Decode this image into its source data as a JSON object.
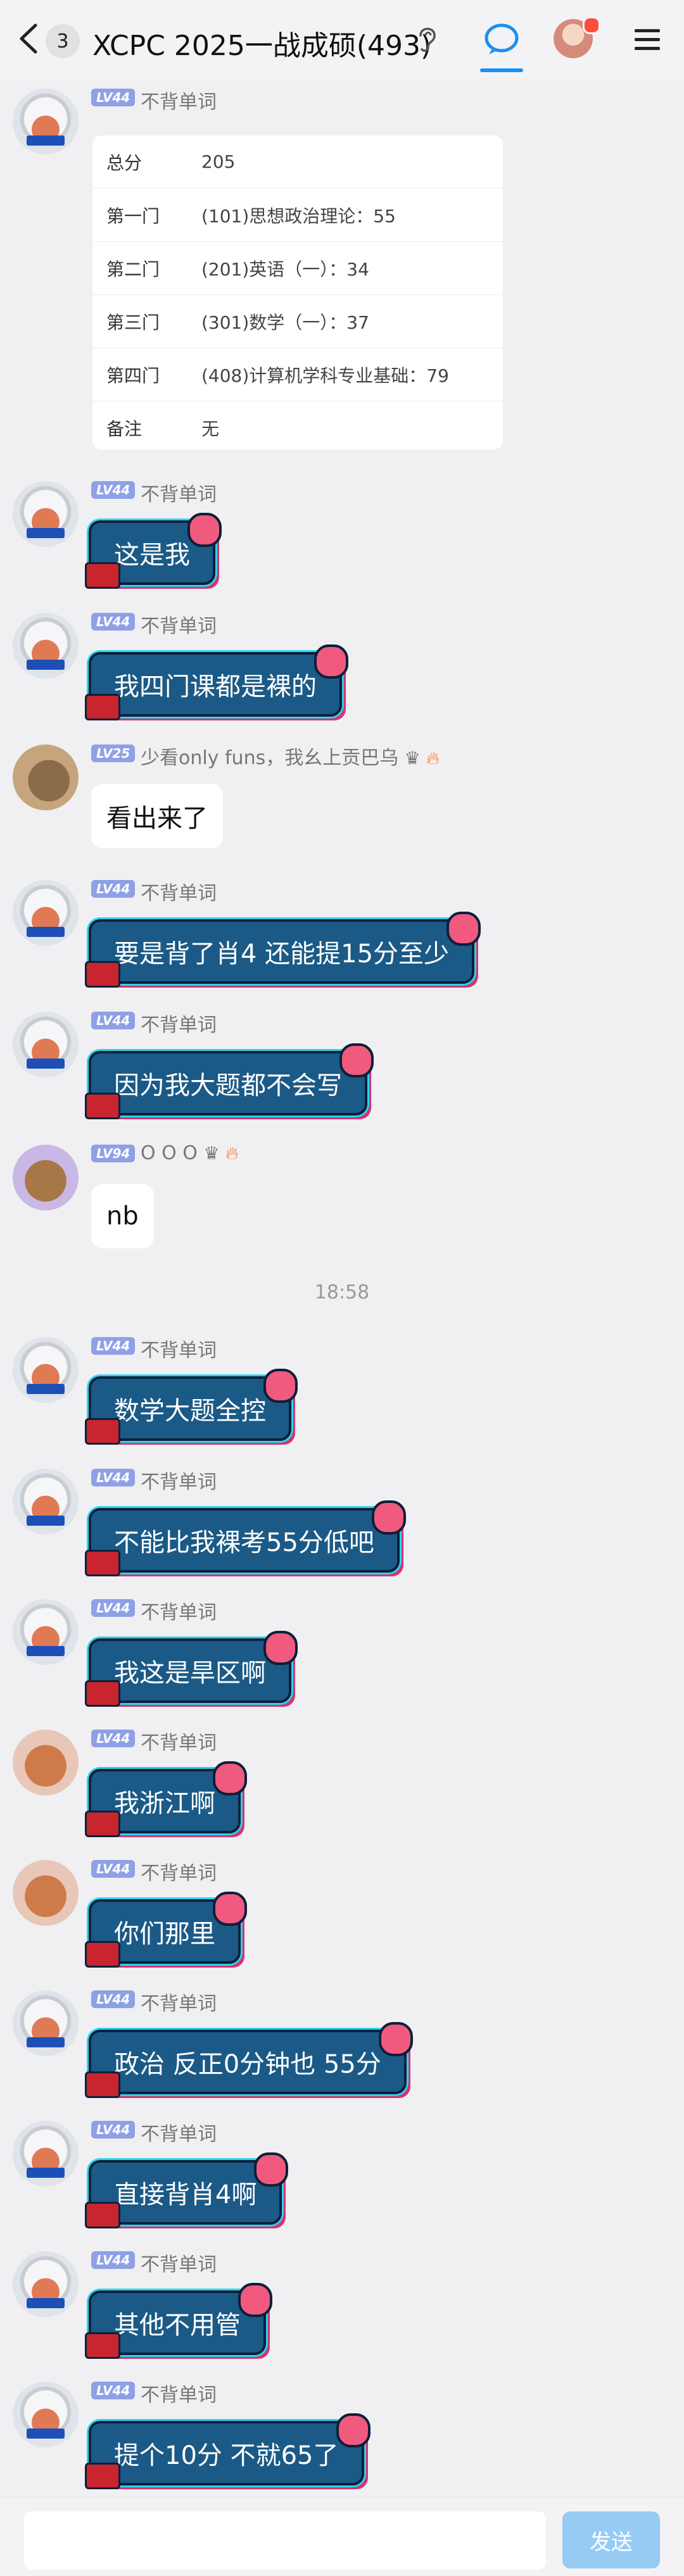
{
  "header": {
    "back_count": "3",
    "title": "XCPC 2025一战成硕(493)"
  },
  "score_card": {
    "rows": [
      {
        "key": "总分",
        "value": "205"
      },
      {
        "key": "第一门",
        "value": "(101)思想政治理论：55"
      },
      {
        "key": "第二门",
        "value": "(201)英语（一）：34"
      },
      {
        "key": "第三门",
        "value": "(301)数学（一）：37"
      },
      {
        "key": "第四门",
        "value": "(408)计算机学科专业基础：79"
      },
      {
        "key": "备注",
        "value": "无"
      }
    ]
  },
  "messages": [
    {
      "level": "LV44",
      "name": "不背单词",
      "text": "这是我"
    },
    {
      "level": "LV44",
      "name": "不背单词",
      "text": "我四门课都是裸的"
    },
    {
      "level": "LV25",
      "name": "少看only funs，我幺上贡巴乌",
      "text": "看出来了"
    },
    {
      "level": "LV44",
      "name": "不背单词",
      "text": "要是背了肖4 还能提15分至少"
    },
    {
      "level": "LV44",
      "name": "不背单词",
      "text": "因为我大题都不会写"
    },
    {
      "level": "LV94",
      "name": "O O O",
      "text": "nb"
    },
    {
      "level": "LV44",
      "name": "不背单词",
      "text": "数学大题全控"
    },
    {
      "level": "LV44",
      "name": "不背单词",
      "text": "不能比我裸考55分低吧"
    },
    {
      "level": "LV44",
      "name": "不背单词",
      "text": "我这是旱区啊"
    },
    {
      "level": "LV44",
      "name": "不背单词",
      "text": "我浙江啊"
    },
    {
      "level": "LV44",
      "name": "不背单词",
      "text": "你们那里"
    },
    {
      "level": "LV44",
      "name": "不背单词",
      "text": "政治 反正0分钟也 55分"
    },
    {
      "level": "LV44",
      "name": "不背单词",
      "text": "直接背肖4啊"
    },
    {
      "level": "LV44",
      "name": "不背单词",
      "text": "其他不用管"
    },
    {
      "level": "LV44",
      "name": "不背单词",
      "text": "提个10分 不就65了"
    }
  ],
  "card_sender": {
    "level": "LV44",
    "name": "不背单词"
  },
  "timestamp": "18:58",
  "input": {
    "placeholder": "",
    "send_label": "发送"
  },
  "icons": [
    "back-icon",
    "ear-icon",
    "chat-bubble-icon",
    "avatar-icon",
    "menu-icon",
    "fire-icon",
    "crown-icon"
  ]
}
